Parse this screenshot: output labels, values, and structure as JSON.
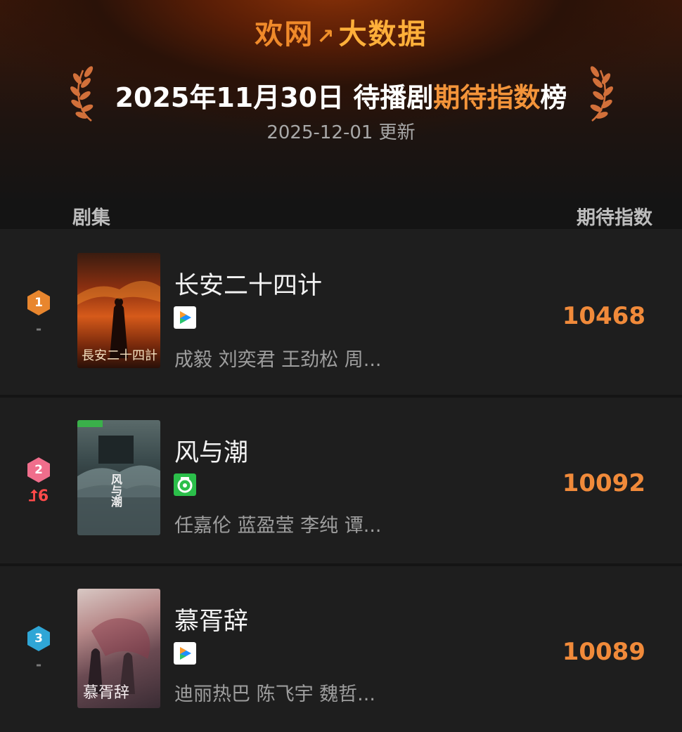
{
  "header": {
    "brand_part1": "欢网",
    "brand_mark": "↗",
    "brand_part2": "大数据",
    "title_date": "2025年11月30日 待播剧",
    "title_highlight": "期待指数",
    "title_suffix": "榜",
    "updated": "2025-12-01 更新"
  },
  "columns": {
    "left": "剧集",
    "right": "期待指数"
  },
  "rows": [
    {
      "rank": "1",
      "badge_color": "#e8862e",
      "change": "-",
      "title": "长安二十四计",
      "platform_icon": "tencent-video-icon",
      "cast": "成毅 刘奕君 王劲松 周...",
      "score": "10468",
      "poster_text": "長安二十四計"
    },
    {
      "rank": "2",
      "badge_color": "#f06e8c",
      "change": "⮥6",
      "title": "风与潮",
      "platform_icon": "iqiyi-icon",
      "cast": "任嘉伦 蓝盈莹 李纯 谭...",
      "score": "10092",
      "poster_text": "风与潮"
    },
    {
      "rank": "3",
      "badge_color": "#2fa6d6",
      "change": "-",
      "title": "慕胥辞",
      "platform_icon": "tencent-video-icon",
      "cast": "迪丽热巴 陈飞宇 魏哲...",
      "score": "10089",
      "poster_text": "慕胥辞"
    }
  ]
}
